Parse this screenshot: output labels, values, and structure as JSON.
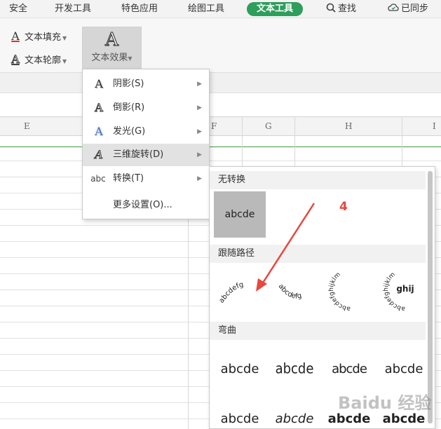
{
  "tabs": [
    {
      "label": "安全",
      "active": false
    },
    {
      "label": "开发工具",
      "active": false
    },
    {
      "label": "特色应用",
      "active": false
    },
    {
      "label": "绘图工具",
      "active": false
    },
    {
      "label": "文本工具",
      "active": true
    },
    {
      "label": "查找",
      "active": false,
      "icon": "search-icon"
    },
    {
      "label": "已同步",
      "active": false,
      "icon": "cloud-sync-icon"
    }
  ],
  "ribbon": {
    "fill_label": "文本填充",
    "outline_label": "文本轮廓",
    "effect_label": "文本效果",
    "glyph": "A"
  },
  "columns": [
    "E",
    "F",
    "G",
    "H",
    "I"
  ],
  "menu": {
    "items": [
      {
        "label": "阴影(S)",
        "glyph": "A",
        "submenu": true,
        "highlighted": false
      },
      {
        "label": "倒影(R)",
        "glyph": "A",
        "submenu": true,
        "highlighted": false
      },
      {
        "label": "发光(G)",
        "glyph": "A",
        "submenu": true,
        "highlighted": false
      },
      {
        "label": "三维旋转(D)",
        "glyph": "A",
        "submenu": true,
        "highlighted": true
      },
      {
        "label": "转换(T)",
        "glyph": "abc",
        "submenu": true,
        "highlighted": false
      },
      {
        "label": "更多设置(O)...",
        "glyph": "",
        "submenu": false,
        "highlighted": false
      }
    ]
  },
  "panel": {
    "section_none": "无转换",
    "section_follow_path": "跟随路径",
    "section_warp": "弯曲",
    "none_sample": "abcde",
    "path_samples": [
      "abcdefg",
      "abcdefg",
      "abcdefghijklm",
      "abcdefghijklm"
    ],
    "path_center_text": "ghij",
    "warp_samples_row1": [
      "abcde",
      "abcde",
      "abcde",
      "abcde"
    ],
    "warp_samples_row2": [
      "abcde",
      "abcde",
      "abcde",
      "abcde"
    ]
  },
  "annotation": {
    "label": "4",
    "color": "#e8473e"
  },
  "watermark": "Baidu 经验",
  "colors": {
    "accent_tab": "#2e9e5b",
    "menu_highlight": "#e2e2e2",
    "selected_swatch": "#b9b9b9",
    "annotation": "#e8473e"
  }
}
